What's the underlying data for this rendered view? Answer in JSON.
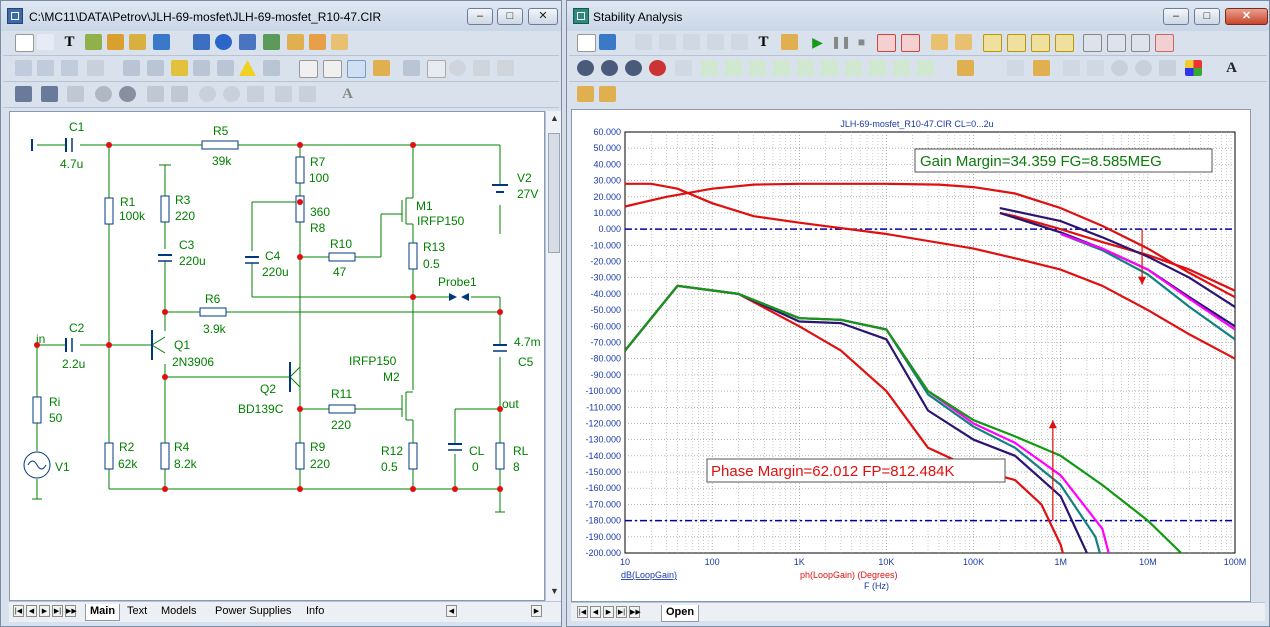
{
  "left_window": {
    "title": "C:\\MC11\\DATA\\Petrov\\JLH-69-mosfet\\JLH-69-mosfet_R10-47.CIR",
    "tabs": [
      "Main",
      "Text",
      "Models",
      "Power Supplies",
      "Info"
    ],
    "active_tab": "Main"
  },
  "right_window": {
    "title": "Stability Analysis",
    "tabs": [
      "Open"
    ],
    "active_tab": "Open"
  },
  "schematic": {
    "labels": {
      "C1": "C1",
      "C1_val": "4.7u",
      "R5": "R5",
      "R5_val": "39k",
      "R1": "R1",
      "R1_val": "100k",
      "R3": "R3",
      "R3_val": "220",
      "C3": "C3",
      "C3_val": "220u",
      "R7": "R7",
      "R7_val": "100",
      "R8_val": "360",
      "R8": "R8",
      "C4": "C4",
      "C4_val": "220u",
      "R10": "R10",
      "R10_val": "47",
      "M1": "M1",
      "M1_model": "IRFP150",
      "R13": "R13",
      "R13_val": "0.5",
      "V2": "V2",
      "V2_val": "27V",
      "Probe1": "Probe1",
      "R6": "R6",
      "R6_val": "3.9k",
      "in": "in",
      "C2": "C2",
      "C2_val": "2.2u",
      "Q1": "Q1",
      "Q1_model": "2N3906",
      "C5_val": "4.7m",
      "C5": "C5",
      "M2_model": "IRFP150",
      "M2": "M2",
      "Ri": "Ri",
      "Ri_val": "50",
      "Q2": "Q2",
      "Q2_model": "BD139C",
      "R11": "R11",
      "R11_val": "220",
      "out": "out",
      "V1": "V1",
      "R2": "R2",
      "R2_val": "62k",
      "R4": "R4",
      "R4_val": "8.2k",
      "R9": "R9",
      "R9_val": "220",
      "R12": "R12",
      "R12_val": "0.5",
      "CL": "CL",
      "CL_val": "0",
      "RL": "RL",
      "RL_val": "8"
    }
  },
  "chart_data": {
    "type": "line",
    "title": "JLH-69-mosfet_R10-47.CIR CL=0...2u",
    "x_scale": "log",
    "xlim": [
      10,
      100000000
    ],
    "ylim": [
      -200,
      60
    ],
    "x_ticks": [
      "10",
      "100",
      "1K",
      "10K",
      "100K",
      "1M",
      "10M",
      "100M"
    ],
    "y_ticks": [
      "60.000",
      "50.000",
      "40.000",
      "30.000",
      "20.000",
      "10.000",
      "0.000",
      "-10.000",
      "-20.000",
      "-30.000",
      "-40.000",
      "-50.000",
      "-60.000",
      "-70.000",
      "-80.000",
      "-90.000",
      "-100.000",
      "-110.000",
      "-120.000",
      "-130.000",
      "-140.000",
      "-150.000",
      "-160.000",
      "-170.000",
      "-180.000",
      "-190.000",
      "-200.000"
    ],
    "xlabel_gain": "dB(LoopGain)",
    "xlabel_phase": "ph(LoopGain) (Degrees)",
    "xlabel": "F (Hz)",
    "grid": true,
    "reference_lines": [
      0,
      -180
    ],
    "colors": {
      "red": "#e01010",
      "navy": "#2a1670",
      "teal": "#118080",
      "magenta": "#ff00ff",
      "green": "#119911",
      "ref": "#0000aa"
    },
    "gain_annotation": "Gain Margin=34.359 FG=8.585MEG",
    "phase_annotation": "Phase Margin=62.012 FP=812.484K",
    "gain_marker": {
      "x": 8585000,
      "y": [
        0,
        -34.359
      ]
    },
    "phase_marker": {
      "x": 812484,
      "y": [
        -180,
        -117.988
      ]
    },
    "series": [
      {
        "color": "red",
        "points": [
          [
            10,
            14
          ],
          [
            30,
            20
          ],
          [
            100,
            25
          ],
          [
            300,
            27.5
          ],
          [
            1000,
            28
          ],
          [
            10000,
            28
          ],
          [
            40000,
            27.5
          ],
          [
            100000,
            26
          ],
          [
            300000,
            22
          ],
          [
            1000000,
            13
          ],
          [
            3000000,
            2
          ],
          [
            10000000,
            -12
          ],
          [
            30000000,
            -27
          ],
          [
            100000000,
            -42
          ]
        ]
      },
      {
        "color": "red",
        "points": [
          [
            10,
            28
          ],
          [
            20,
            28
          ],
          [
            40,
            25
          ],
          [
            100,
            16
          ],
          [
            300,
            8
          ],
          [
            1000,
            4
          ],
          [
            10000,
            -3
          ],
          [
            100000,
            -12
          ],
          [
            300000,
            -18
          ],
          [
            1000000,
            -25
          ],
          [
            3000000,
            -35
          ],
          [
            10000000,
            -50
          ],
          [
            30000000,
            -65
          ],
          [
            100000000,
            -80
          ]
        ]
      },
      {
        "color": "red",
        "points": [
          [
            200000,
            10
          ],
          [
            300000,
            8
          ],
          [
            1000000,
            0
          ],
          [
            3000000,
            -8
          ],
          [
            10000000,
            -16
          ],
          [
            30000000,
            -25
          ],
          [
            100000000,
            -38
          ]
        ]
      },
      {
        "color": "navy",
        "points": [
          [
            200000,
            13
          ],
          [
            300000,
            11
          ],
          [
            1000000,
            5
          ],
          [
            3000000,
            -5
          ],
          [
            10000000,
            -17
          ],
          [
            30000000,
            -30
          ],
          [
            100000000,
            -48
          ]
        ]
      },
      {
        "color": "navy",
        "points": [
          [
            200000,
            10
          ],
          [
            300000,
            7
          ],
          [
            1000000,
            -2
          ],
          [
            3000000,
            -12
          ],
          [
            10000000,
            -25
          ],
          [
            30000000,
            -42
          ],
          [
            100000000,
            -60
          ]
        ]
      },
      {
        "color": "teal",
        "points": [
          [
            1000000,
            -3
          ],
          [
            3000000,
            -13
          ],
          [
            10000000,
            -28
          ],
          [
            30000000,
            -48
          ],
          [
            100000000,
            -68
          ]
        ]
      },
      {
        "color": "magenta",
        "points": [
          [
            1000000,
            -3
          ],
          [
            3000000,
            -12
          ],
          [
            10000000,
            -25
          ],
          [
            30000000,
            -43
          ],
          [
            100000000,
            -62
          ]
        ]
      },
      {
        "color": "red",
        "points": [
          [
            10,
            -75
          ],
          [
            40,
            -35
          ],
          [
            200,
            -40
          ],
          [
            1000,
            -60
          ],
          [
            3000,
            -75
          ],
          [
            10000,
            -100
          ],
          [
            30000,
            -135
          ],
          [
            100000,
            -148
          ],
          [
            300000,
            -155
          ],
          [
            600000,
            -170
          ],
          [
            1000000,
            -195
          ],
          [
            1500000,
            -230
          ]
        ]
      },
      {
        "color": "navy",
        "points": [
          [
            10,
            -75
          ],
          [
            40,
            -35
          ],
          [
            200,
            -40
          ],
          [
            1000,
            -57
          ],
          [
            3000,
            -58
          ],
          [
            10000,
            -68
          ],
          [
            30000,
            -112
          ],
          [
            100000,
            -130
          ],
          [
            300000,
            -140
          ],
          [
            1000000,
            -165
          ],
          [
            2000000,
            -200
          ],
          [
            3000000,
            -230
          ]
        ]
      },
      {
        "color": "teal",
        "points": [
          [
            10,
            -75
          ],
          [
            40,
            -35
          ],
          [
            200,
            -40
          ],
          [
            1000,
            -55
          ],
          [
            3000,
            -56
          ],
          [
            10000,
            -62
          ],
          [
            30000,
            -102
          ],
          [
            100000,
            -122
          ],
          [
            300000,
            -135
          ],
          [
            1000000,
            -158
          ],
          [
            2500000,
            -190
          ],
          [
            4000000,
            -230
          ]
        ]
      },
      {
        "color": "magenta",
        "points": [
          [
            10,
            -75
          ],
          [
            40,
            -35
          ],
          [
            200,
            -40
          ],
          [
            1000,
            -55
          ],
          [
            3000,
            -56
          ],
          [
            10000,
            -62
          ],
          [
            30000,
            -100
          ],
          [
            100000,
            -120
          ],
          [
            300000,
            -132
          ],
          [
            1000000,
            -152
          ],
          [
            3000000,
            -185
          ],
          [
            5000000,
            -230
          ]
        ]
      },
      {
        "color": "green",
        "points": [
          [
            10,
            -75
          ],
          [
            40,
            -35
          ],
          [
            200,
            -40
          ],
          [
            1000,
            -55
          ],
          [
            3000,
            -56
          ],
          [
            10000,
            -62
          ],
          [
            30000,
            -100
          ],
          [
            100000,
            -118
          ],
          [
            300000,
            -128
          ],
          [
            1000000,
            -140
          ],
          [
            3000000,
            -158
          ],
          [
            10000000,
            -180
          ],
          [
            30000000,
            -205
          ]
        ]
      }
    ]
  }
}
